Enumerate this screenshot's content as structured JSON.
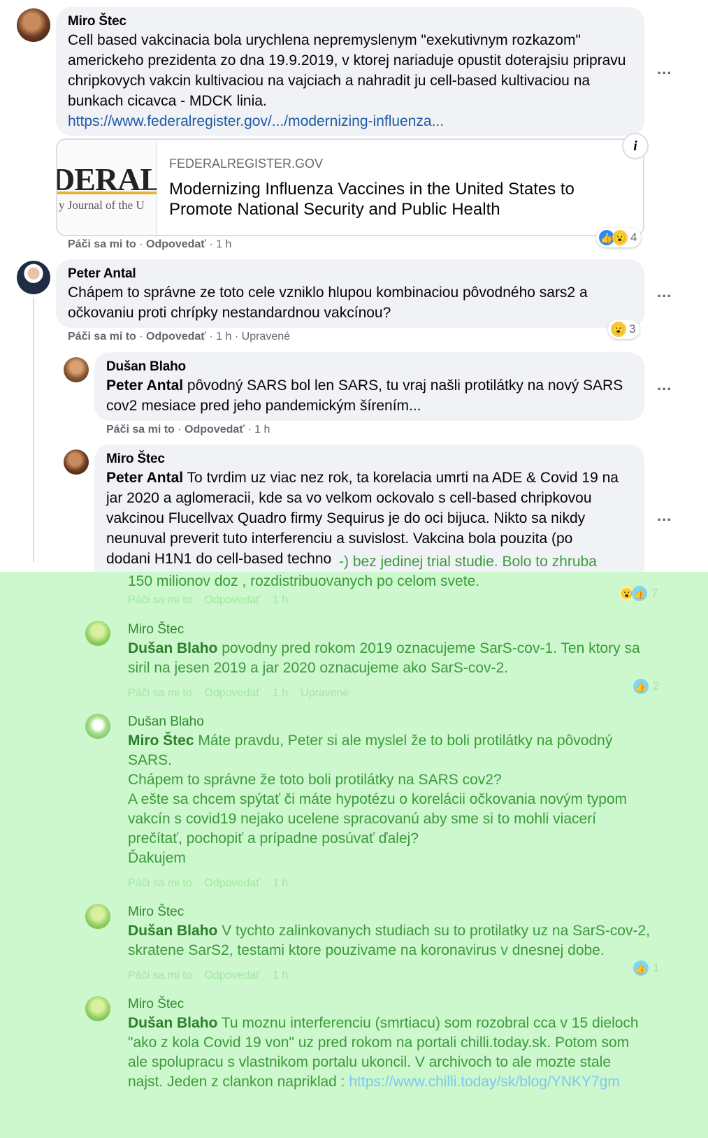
{
  "comments": [
    {
      "author": "Miro Štec",
      "text": "Cell based vakcinacia bola urychlena nepremyslenym \"exekutivnym rozkazom\" americkeho prezidenta zo dna 19.9.2019, v ktorej nariaduje opustit doterajsiu pripravu chripkovych vakcin kultivaciou na vajciach a nahradit ju cell-based kultivaciou na bunkach cicavca - MDCK linia.",
      "link": "https://www.federalregister.gov/.../modernizing-influenza...",
      "like_label": "Páči sa mi to",
      "reply_label": "Odpovedať",
      "time": "1 h",
      "reaction_count": "4",
      "preview": {
        "image_big_text": "DERAL",
        "image_small_text": "y Journal of the U",
        "domain": "FEDERALREGISTER.GOV",
        "title": "Modernizing Influenza Vaccines in the United States to Promote National Security and Public Health",
        "info_icon": "i"
      }
    },
    {
      "author": "Peter Antal",
      "text": "Chápem to správne ze toto cele vzniklo hlupou kombinaciou pôvodného sars2 a očkovaniu proti chrípky nestandardnou vakcínou?",
      "like_label": "Páči sa mi to",
      "reply_label": "Odpovedať",
      "time": "1 h",
      "edited": "Upravené",
      "reaction_count": "3"
    },
    {
      "author": "Dušan Blaho",
      "mention": "Peter Antal",
      "text": " pôvodný SARS bol len SARS, tu vraj našli protilátky na nový SARS cov2 mesiace pred jeho pandemickým šírením...",
      "like_label": "Páči sa mi to",
      "reply_label": "Odpovedať",
      "time": "1 h"
    },
    {
      "author": "Miro Štec",
      "mention": "Peter Antal",
      "text_lines": [
        " To tvrdim uz viac nez rok, ta korelacia umrti na ADE & Covid 19 na",
        "jar 2020 a aglomeracii, kde sa vo velkom ockovalo s cell-based chripkovou",
        "vakcinou Flucellvax Quadro firmy Sequirus je do oci bijuca. Nikto sa nikdy",
        "neunuval preverit tuto interferenciu a suvislost. Vakcina bola pouzita (po",
        "dodani H1N1 do cell-based techno"
      ],
      "text_cont_lines": [
        "-) bez jedinej trial studie. Bolo to zhruba",
        "150 milionov doz , rozdistribuovanych po celom svete."
      ],
      "like_label": "Páči sa mi to",
      "reply_label": "Odpovedať",
      "time": "1 h",
      "reaction_count": "7"
    },
    {
      "author": "Miro Štec",
      "mention": "Dušan Blaho",
      "text_lines": [
        " povodny pred rokom 2019 oznacujeme SarS-cov-1. Ten ktory sa",
        "siril na jesen 2019 a jar 2020 oznacujeme ako SarS-cov-2."
      ],
      "like_label": "Páči sa mi to",
      "reply_label": "Odpovedať",
      "time": "1 h",
      "edited": "Upravené",
      "reaction_count": "2"
    },
    {
      "author": "Dušan Blaho",
      "mention": "Miro Štec",
      "text_lines": [
        " Máte pravdu, Peter si ale myslel že to boli protilátky na pôvodný",
        "SARS.",
        "Chápem to správne že toto boli protilátky na SARS cov2?",
        "A ešte sa chcem spýtať či máte hypotézu o korelácii očkovania novým typom",
        "vakcín s covid19 nejako ucelene spracovanú aby sme si to mohli viacerí",
        "prečítať, pochopiť a prípadne posúvať ďalej?",
        "Ďakujem"
      ],
      "like_label": "Páči sa mi to",
      "reply_label": "Odpovedať",
      "time": "1 h"
    },
    {
      "author": "Miro Štec",
      "mention": "Dušan Blaho",
      "text_lines": [
        " V tychto zalinkovanych studiach su to protilatky uz na SarS-cov-2,",
        "skratene SarS2, testami ktore pouzivame na koronavirus v dnesnej dobe."
      ],
      "like_label": "Páči sa mi to",
      "reply_label": "Odpovedať",
      "time": "1 h",
      "reaction_count": "1"
    },
    {
      "author": "Miro Štec",
      "mention": "Dušan Blaho",
      "text_lines": [
        " Tu moznu interferenciu (smrtiacu) som rozobral cca v 15 dieloch",
        "\"ako z kola Covid 19 von\" uz pred rokom na portali chilli.today.sk. Potom som",
        "ale spolupracu s vlastnikom portalu ukoncil. V archivoch to ale mozte stale",
        "najst. Jeden z clankon napriklad : "
      ],
      "link": "https://www.chilli.today/sk/blog/YNKY7gm"
    }
  ],
  "more_icon": "...",
  "colors": {
    "bubble": "#f0f2f5",
    "link": "#1e5aa8",
    "overlay": "#cdf7cd",
    "like": "#2d88ff",
    "wow": "#f7c93e"
  },
  "icons": [
    "avatar",
    "like-icon",
    "wow-icon",
    "more-options-icon",
    "info-icon"
  ]
}
